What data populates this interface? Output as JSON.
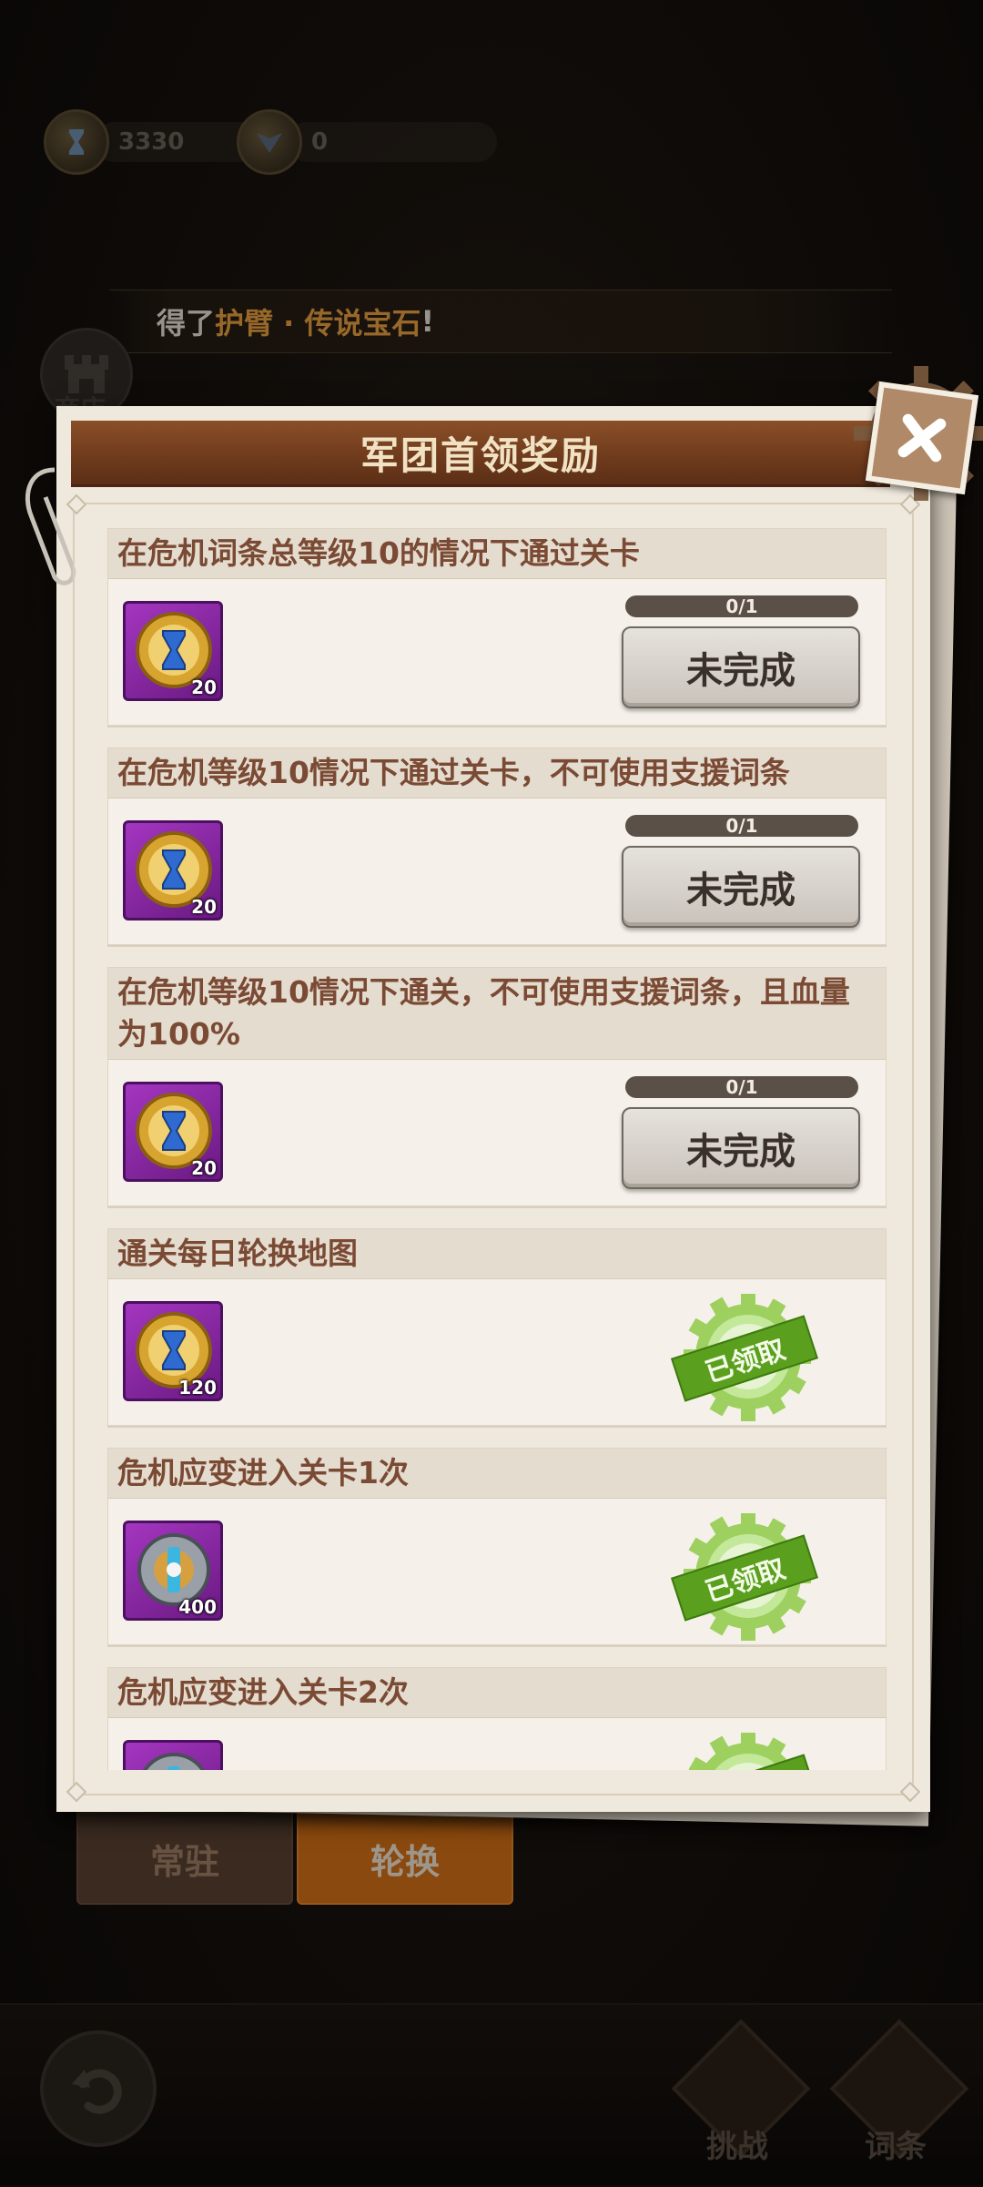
{
  "currency": [
    {
      "icon": "hourglass-coin-icon",
      "value": "3330"
    },
    {
      "icon": "emblem-coin-icon",
      "value": "0"
    }
  ],
  "notice": {
    "prefix": "得了",
    "highlight": "护臂 · 传说宝石",
    "suffix": "!"
  },
  "sidebar": {
    "shop_label": "商店"
  },
  "modal": {
    "title": "军团首领奖励",
    "tasks": [
      {
        "title": "在危机词条总等级10的情况下通过关卡",
        "reward_count": "20",
        "reward_icon": "hourglass-token-icon",
        "progress": "0/1",
        "status": "未完成",
        "claimed": false
      },
      {
        "title": "在危机等级10情况下通过关卡，不可使用支援词条",
        "reward_count": "20",
        "reward_icon": "hourglass-token-icon",
        "progress": "0/1",
        "status": "未完成",
        "claimed": false
      },
      {
        "title": "在危机等级10情况下通关，不可使用支援词条，且血量为100%",
        "reward_count": "20",
        "reward_icon": "hourglass-token-icon",
        "progress": "0/1",
        "status": "未完成",
        "claimed": false
      },
      {
        "title": "通关每日轮换地图",
        "reward_count": "120",
        "reward_icon": "hourglass-token-icon",
        "status": "已领取",
        "claimed": true
      },
      {
        "title": "危机应变进入关卡1次",
        "reward_count": "400",
        "reward_icon": "mechanical-part-icon",
        "status": "已领取",
        "claimed": true
      },
      {
        "title": "危机应变进入关卡2次",
        "reward_count": "",
        "reward_icon": "mechanical-part-icon",
        "status": "已领取",
        "claimed": true
      }
    ]
  },
  "tabs": {
    "normal": "常驻",
    "rotate": "轮换"
  },
  "bottom_nav": {
    "challenge": "挑战",
    "terms": "词条"
  },
  "colors": {
    "accent": "#d47016",
    "title_bar": "#6e3a1c",
    "claimed": "#5aa01e"
  }
}
